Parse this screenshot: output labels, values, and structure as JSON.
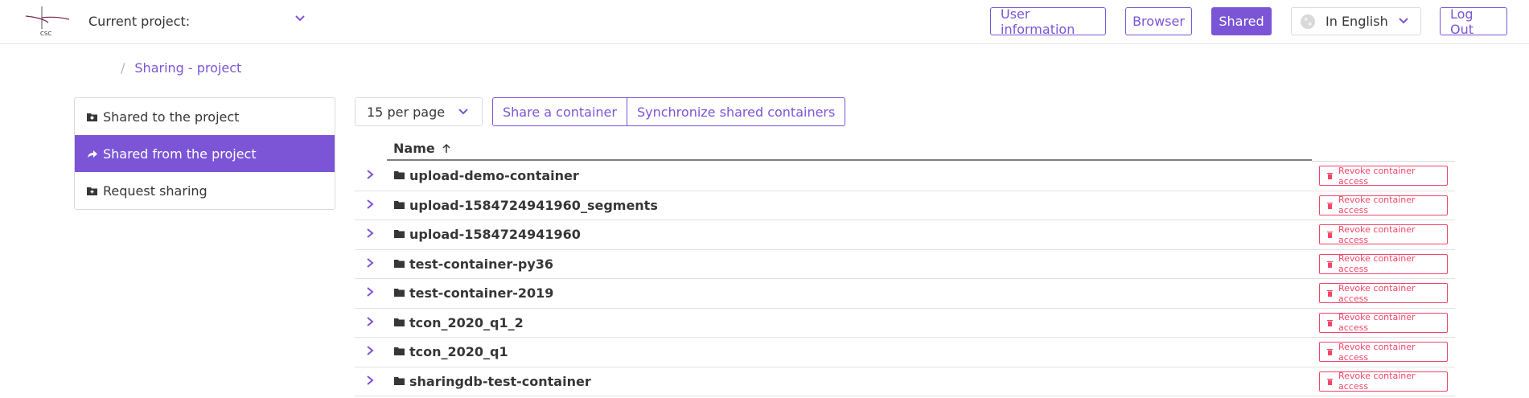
{
  "header": {
    "project_label": "Current project:",
    "project_value": "",
    "nav": {
      "user_info": "User information",
      "browser": "Browser",
      "shared": "Shared",
      "logout": "Log Out"
    },
    "language": "In English"
  },
  "breadcrumb": {
    "separator": "/",
    "current": "Sharing - project"
  },
  "sidebar": {
    "items": [
      {
        "label": "Shared to the project",
        "icon": "folder-share-icon",
        "active": false
      },
      {
        "label": "Shared from the project",
        "icon": "share-arrow-icon",
        "active": true
      },
      {
        "label": "Request sharing",
        "icon": "folder-plus-icon",
        "active": false
      }
    ]
  },
  "toolbar": {
    "per_page": "15 per page",
    "share_container": "Share a container",
    "sync_containers": "Synchronize shared containers"
  },
  "table": {
    "name_header": "Name",
    "revoke_label": "Revoke container access",
    "rows": [
      {
        "name": "upload-demo-container"
      },
      {
        "name": "upload-1584724941960_segments"
      },
      {
        "name": "upload-1584724941960"
      },
      {
        "name": "test-container-py36"
      },
      {
        "name": "test-container-2019"
      },
      {
        "name": "tcon_2020_q1_2"
      },
      {
        "name": "tcon_2020_q1"
      },
      {
        "name": "sharingdb-test-container"
      }
    ]
  },
  "colors": {
    "accent": "#7b55d6",
    "danger": "#f14668"
  }
}
